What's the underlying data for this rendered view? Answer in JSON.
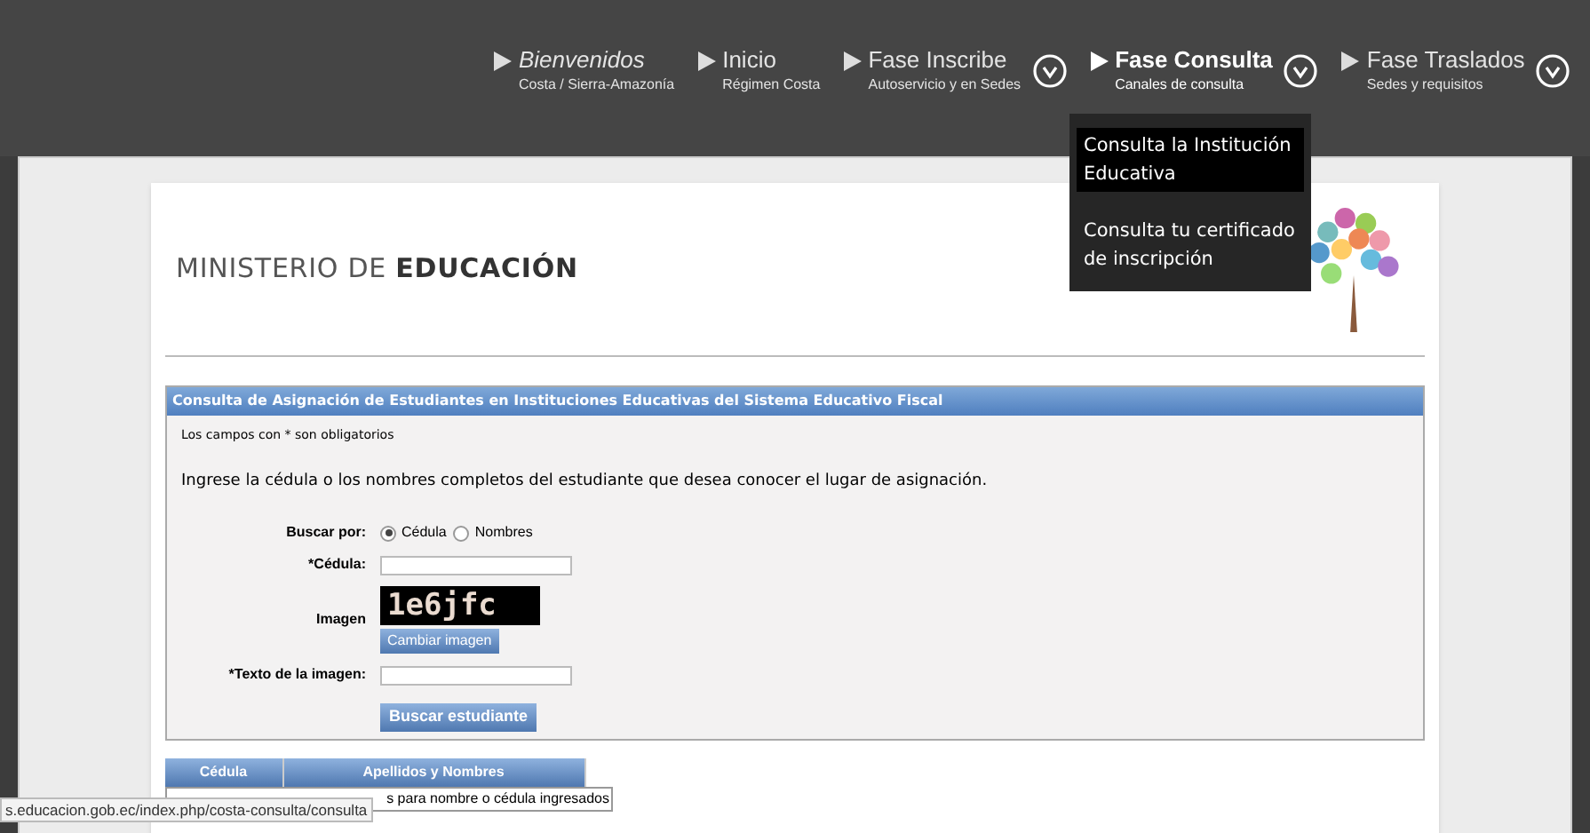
{
  "nav": [
    {
      "title": "Bienvenidos",
      "subtitle": "Costa / Sierra-Amazonía",
      "kind": "greeting",
      "dropdown": false,
      "selected": false
    },
    {
      "title": "Inicio",
      "subtitle": "Régimen Costa",
      "kind": "section",
      "dropdown": false,
      "selected": false
    },
    {
      "title": "Fase Inscribe",
      "subtitle": "Autoservicio y en Sedes",
      "kind": "section",
      "dropdown": true,
      "selected": false
    },
    {
      "title": "Fase Consulta",
      "subtitle": "Canales de consulta",
      "kind": "section",
      "dropdown": true,
      "selected": true
    },
    {
      "title": "Fase Traslados",
      "subtitle": "Sedes y requisitos",
      "kind": "section",
      "dropdown": true,
      "selected": false
    }
  ],
  "dropdown_menu": [
    {
      "label": "Consulta la Institución Educativa",
      "selected": true
    },
    {
      "label": "Consulta tu certificado de inscripción",
      "selected": false
    }
  ],
  "logo": {
    "text_light": "MINISTERIO DE ",
    "text_bold": "EDUCACIÓN"
  },
  "form": {
    "title": "Consulta de Asignación de Estudiantes en Instituciones Educativas del Sistema Educativo Fiscal",
    "required_note": "Los campos con * son obligatorios",
    "instructions": "Ingrese la cédula o los nombres completos del estudiante que desea conocer el lugar de asignación.",
    "search_by_label": "Buscar por:",
    "search_options": [
      {
        "label": "Cédula",
        "selected": true
      },
      {
        "label": "Nombres",
        "selected": false
      }
    ],
    "cedula_label": "*Cédula:",
    "image_label": "Imagen",
    "captcha": "1e6jfc",
    "change_image_button": "Cambiar imagen",
    "image_text_label": "*Texto de la imagen:",
    "submit_button": "Buscar estudiante"
  },
  "table": {
    "columns": [
      "Cédula",
      "Apellidos y Nombres"
    ],
    "message": "s para nombre o cédula ingresados"
  },
  "status_bar": "s.educacion.gob.ec/index.php/costa-consulta/consulta"
}
